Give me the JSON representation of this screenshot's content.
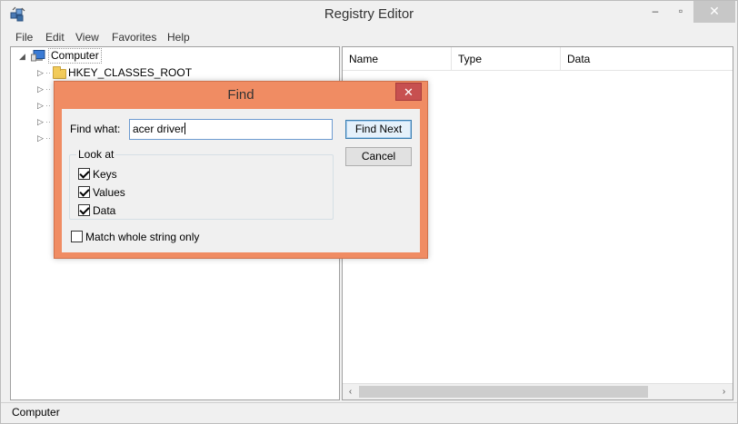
{
  "window": {
    "title": "Registry Editor",
    "close_glyph": "✕",
    "min_glyph": "–",
    "max_glyph": "▫"
  },
  "menubar": {
    "items": [
      "File",
      "Edit",
      "View",
      "Favorites",
      "Help"
    ]
  },
  "tree": {
    "root_label": "Computer",
    "first_child_label": "HKEY_CLASSES_ROOT"
  },
  "list": {
    "columns": [
      "Name",
      "Type",
      "Data"
    ]
  },
  "statusbar": {
    "text": "Computer"
  },
  "find_dialog": {
    "title": "Find",
    "close_glyph": "✕",
    "find_what_label": "Find what:",
    "find_what_value": "acer driver",
    "find_next_label": "Find Next",
    "cancel_label": "Cancel",
    "look_at_label": "Look at",
    "options": [
      {
        "label": "Keys",
        "checked": true
      },
      {
        "label": "Values",
        "checked": true
      },
      {
        "label": "Data",
        "checked": true
      }
    ],
    "match_whole_label": "Match whole string only",
    "match_whole_checked": false
  },
  "colors": {
    "dialog_frame": "#f08c63",
    "close_button": "#c75050",
    "folder": "#f2cb5a"
  }
}
